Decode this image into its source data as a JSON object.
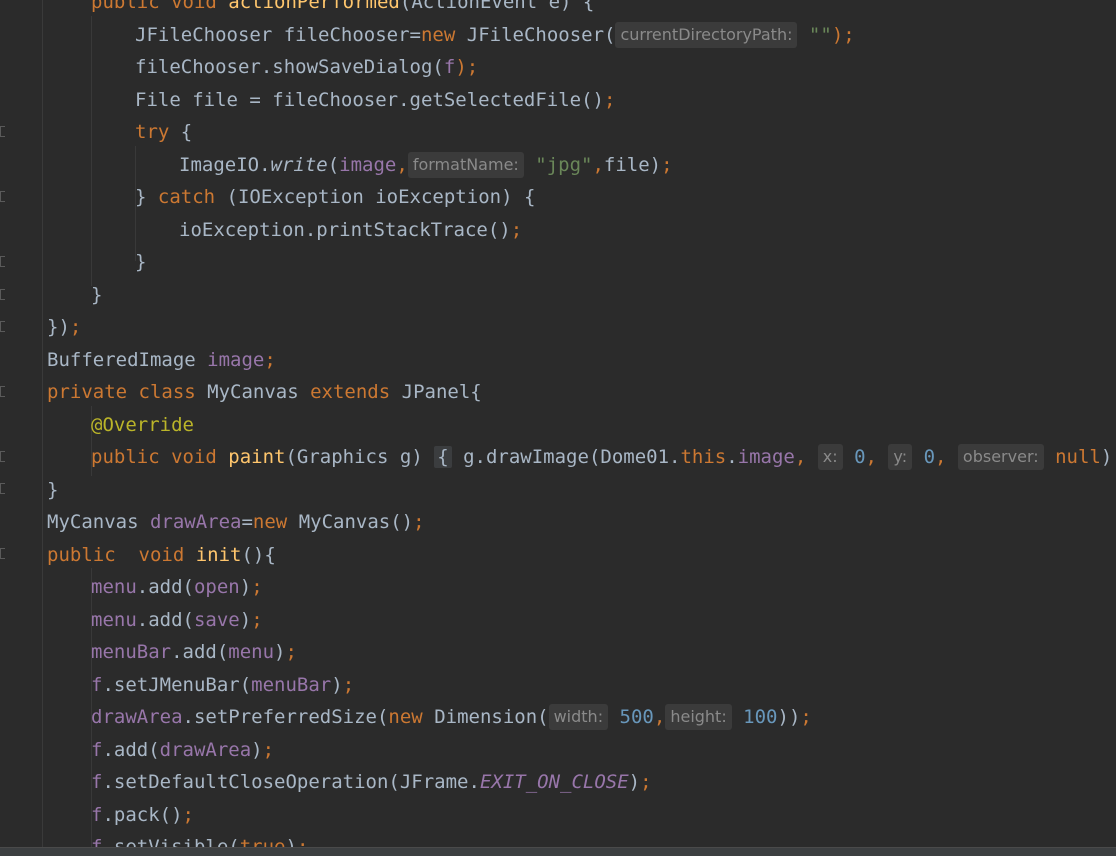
{
  "editor": {
    "lines": [
      {
        "id": "l0",
        "segments": [
          {
            "t": "public void ",
            "c": "kw"
          },
          {
            "t": "actionPerformed",
            "c": "mth"
          },
          {
            "t": "(ActionEvent e) {",
            "c": ""
          }
        ]
      },
      {
        "id": "l1",
        "segments": [
          {
            "t": "JFileChooser fileChooser=",
            "c": ""
          },
          {
            "t": "new",
            "c": "kw"
          },
          {
            "t": " JFileChooser(",
            "c": ""
          },
          {
            "hint": "currentDirectoryPath:"
          },
          {
            "t": "\"\"",
            "c": "str"
          },
          {
            "t": ");",
            "c": "kw"
          }
        ]
      },
      {
        "id": "l2",
        "segments": [
          {
            "t": "fileChooser.showSaveDialog(",
            "c": ""
          },
          {
            "t": "f",
            "c": "fld"
          },
          {
            "t": ");",
            "c": "kw"
          }
        ]
      },
      {
        "id": "l3",
        "segments": [
          {
            "t": "File file = fileChooser.getSelectedFile()",
            "c": ""
          },
          {
            "t": ";",
            "c": "kw"
          }
        ]
      },
      {
        "id": "l4",
        "segments": [
          {
            "t": "try",
            "c": "kw"
          },
          {
            "t": " {",
            "c": ""
          }
        ]
      },
      {
        "id": "l5",
        "segments": [
          {
            "t": "ImageIO.",
            "c": ""
          },
          {
            "t": "write",
            "c": "it"
          },
          {
            "t": "(",
            "c": ""
          },
          {
            "t": "image",
            "c": "fld"
          },
          {
            "t": ",",
            "c": "kw"
          },
          {
            "hint": "formatName:"
          },
          {
            "t": "\"jpg\"",
            "c": "str"
          },
          {
            "t": ",",
            "c": "kw"
          },
          {
            "t": "file)",
            "c": ""
          },
          {
            "t": ";",
            "c": "kw"
          }
        ]
      },
      {
        "id": "l6",
        "segments": [
          {
            "t": "} ",
            "c": ""
          },
          {
            "t": "catch",
            "c": "kw"
          },
          {
            "t": " (IOException ioException) {",
            "c": ""
          }
        ]
      },
      {
        "id": "l7",
        "segments": [
          {
            "t": "ioException.printStackTrace()",
            "c": ""
          },
          {
            "t": ";",
            "c": "kw"
          }
        ]
      },
      {
        "id": "l8",
        "segments": [
          {
            "t": "}",
            "c": ""
          }
        ]
      },
      {
        "id": "l9",
        "segments": [
          {
            "t": "}",
            "c": ""
          }
        ]
      },
      {
        "id": "l10",
        "segments": [
          {
            "t": "})",
            "c": ""
          },
          {
            "t": ";",
            "c": "kw"
          }
        ]
      },
      {
        "id": "l11",
        "segments": [
          {
            "t": "BufferedImage ",
            "c": ""
          },
          {
            "t": "image",
            "c": "fld"
          },
          {
            "t": ";",
            "c": "kw"
          }
        ]
      },
      {
        "id": "l12",
        "segments": [
          {
            "t": "private class ",
            "c": "kw"
          },
          {
            "t": "MyCanvas ",
            "c": ""
          },
          {
            "t": "extends ",
            "c": "kw"
          },
          {
            "t": "JPanel{",
            "c": ""
          }
        ]
      },
      {
        "id": "l13",
        "segments": [
          {
            "t": "@Override",
            "c": "ann"
          }
        ]
      },
      {
        "id": "l14",
        "segments": [
          {
            "t": "public void ",
            "c": "kw"
          },
          {
            "t": "paint",
            "c": "mth"
          },
          {
            "t": "(Graphics g)",
            "c": ""
          },
          {
            "t": " ",
            "c": ""
          },
          {
            "brace": "{"
          },
          {
            "t": " g.drawImage(Dome01.",
            "c": ""
          },
          {
            "t": "this",
            "c": "kw"
          },
          {
            "t": ".",
            "c": ""
          },
          {
            "t": "image",
            "c": "fld"
          },
          {
            "t": ", ",
            "c": "kw"
          },
          {
            "hint": "x:"
          },
          {
            "t": "0",
            "c": "num"
          },
          {
            "t": ", ",
            "c": "kw"
          },
          {
            "hint": "y:"
          },
          {
            "t": "0",
            "c": "num"
          },
          {
            "t": ", ",
            "c": "kw"
          },
          {
            "hint": "observer:"
          },
          {
            "t": "null",
            "c": "kw"
          },
          {
            "t": ")",
            "c": ""
          },
          {
            "t": ";",
            "c": "kw"
          },
          {
            "brace": "}"
          }
        ]
      },
      {
        "id": "l15",
        "segments": [
          {
            "t": "}",
            "c": ""
          }
        ]
      },
      {
        "id": "l16",
        "segments": [
          {
            "t": "MyCanvas ",
            "c": ""
          },
          {
            "t": "drawArea",
            "c": "fld"
          },
          {
            "t": "=",
            "c": ""
          },
          {
            "t": "new",
            "c": "kw"
          },
          {
            "t": " MyCanvas()",
            "c": ""
          },
          {
            "t": ";",
            "c": "kw"
          }
        ]
      },
      {
        "id": "l17",
        "segments": [
          {
            "t": "public  void ",
            "c": "kw"
          },
          {
            "t": "init",
            "c": "mth"
          },
          {
            "t": "(){",
            "c": ""
          }
        ]
      },
      {
        "id": "l18",
        "segments": [
          {
            "t": "menu",
            "c": "fld"
          },
          {
            "t": ".add(",
            "c": ""
          },
          {
            "t": "open",
            "c": "fld"
          },
          {
            "t": ")",
            "c": ""
          },
          {
            "t": ";",
            "c": "kw"
          }
        ]
      },
      {
        "id": "l19",
        "segments": [
          {
            "t": "menu",
            "c": "fld"
          },
          {
            "t": ".add(",
            "c": ""
          },
          {
            "t": "save",
            "c": "fld"
          },
          {
            "t": ")",
            "c": ""
          },
          {
            "t": ";",
            "c": "kw"
          }
        ]
      },
      {
        "id": "l20",
        "segments": [
          {
            "t": "menuBar",
            "c": "fld"
          },
          {
            "t": ".add(",
            "c": ""
          },
          {
            "t": "menu",
            "c": "fld"
          },
          {
            "t": ")",
            "c": ""
          },
          {
            "t": ";",
            "c": "kw"
          }
        ]
      },
      {
        "id": "l21",
        "segments": [
          {
            "t": "f",
            "c": "fld"
          },
          {
            "t": ".setJMenuBar(",
            "c": ""
          },
          {
            "t": "menuBar",
            "c": "fld"
          },
          {
            "t": ")",
            "c": ""
          },
          {
            "t": ";",
            "c": "kw"
          }
        ]
      },
      {
        "id": "l22",
        "segments": [
          {
            "t": "drawArea",
            "c": "fld"
          },
          {
            "t": ".setPreferredSize(",
            "c": ""
          },
          {
            "t": "new",
            "c": "kw"
          },
          {
            "t": " Dimension(",
            "c": ""
          },
          {
            "hint": "width:"
          },
          {
            "t": "500",
            "c": "num"
          },
          {
            "t": ",",
            "c": "kw"
          },
          {
            "hint": "height:"
          },
          {
            "t": "100",
            "c": "num"
          },
          {
            "t": "))",
            "c": ""
          },
          {
            "t": ";",
            "c": "kw"
          }
        ]
      },
      {
        "id": "l23",
        "segments": [
          {
            "t": "f",
            "c": "fld"
          },
          {
            "t": ".add(",
            "c": ""
          },
          {
            "t": "drawArea",
            "c": "fld"
          },
          {
            "t": ")",
            "c": ""
          },
          {
            "t": ";",
            "c": "kw"
          }
        ]
      },
      {
        "id": "l24",
        "segments": [
          {
            "t": "f",
            "c": "fld"
          },
          {
            "t": ".setDefaultCloseOperation(JFrame.",
            "c": ""
          },
          {
            "t": "EXIT_ON_CLOSE",
            "c": "fld it"
          },
          {
            "t": ")",
            "c": ""
          },
          {
            "t": ";",
            "c": "kw"
          }
        ]
      },
      {
        "id": "l25",
        "segments": [
          {
            "t": "f",
            "c": "fld"
          },
          {
            "t": ".pack()",
            "c": ""
          },
          {
            "t": ";",
            "c": "kw"
          }
        ]
      },
      {
        "id": "l26",
        "segments": [
          {
            "t": "f",
            "c": "fld"
          },
          {
            "t": ".setVisible(",
            "c": ""
          },
          {
            "t": "true",
            "c": "kw"
          },
          {
            "t": ")",
            "c": ""
          },
          {
            "t": ";",
            "c": "kw"
          }
        ]
      }
    ]
  }
}
